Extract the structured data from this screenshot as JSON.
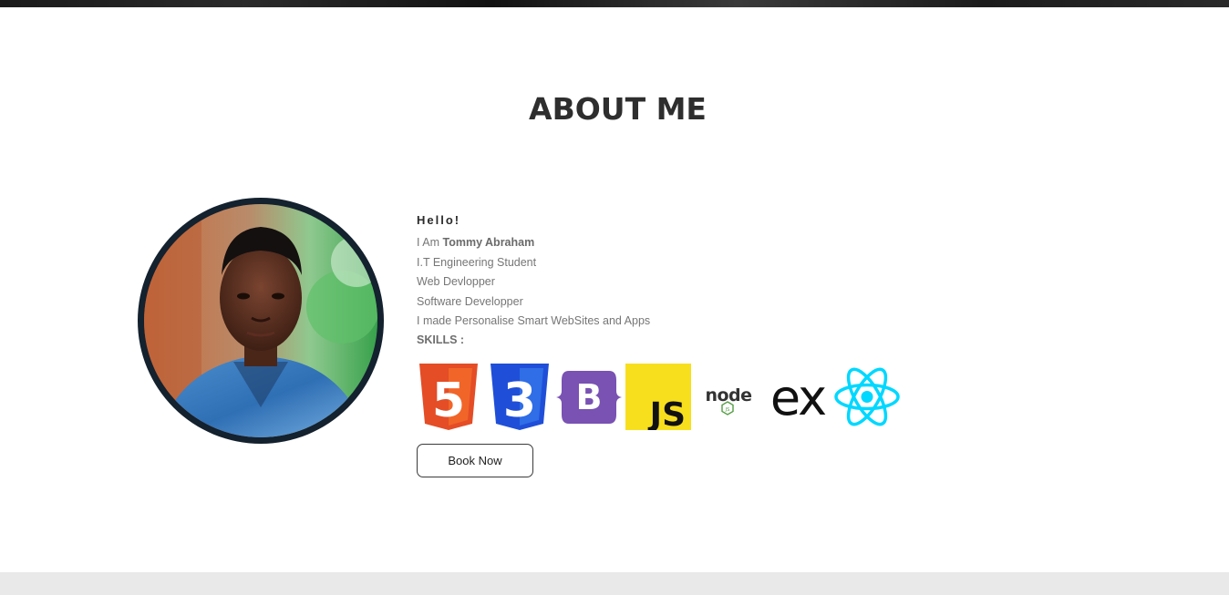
{
  "section": {
    "title": "ABOUT ME"
  },
  "profile": {
    "greeting": "Hello!",
    "intro_prefix": "I Am",
    "name": "Tommy Abraham",
    "lines": [
      "I.T Engineering Student",
      "Web Devlopper",
      "Software Developper",
      "I made Personalise Smart WebSites and Apps"
    ],
    "skills_label": "SKILLS :"
  },
  "skills": {
    "icons": [
      "html5-icon",
      "css3-icon",
      "bootstrap-icon",
      "javascript-icon",
      "nodejs-icon",
      "express-icon",
      "react-icon"
    ],
    "logo_text": {
      "html5": "5",
      "css3": "3",
      "bootstrap": "B",
      "javascript": "JS",
      "nodejs": "node",
      "nodejs_badge": "JS",
      "express": "ex"
    }
  },
  "actions": {
    "book_label": "Book Now"
  },
  "colors": {
    "heading": "#2e2e2e",
    "text": "#767676",
    "avatar_ring": "#14212e",
    "html5": "#e44d26",
    "css3": "#1572b6",
    "bootstrap": "#7952b3",
    "javascript": "#f7df1e",
    "react": "#00d8ff",
    "node": "#539e43",
    "footer_band": "#e9e9e9"
  }
}
